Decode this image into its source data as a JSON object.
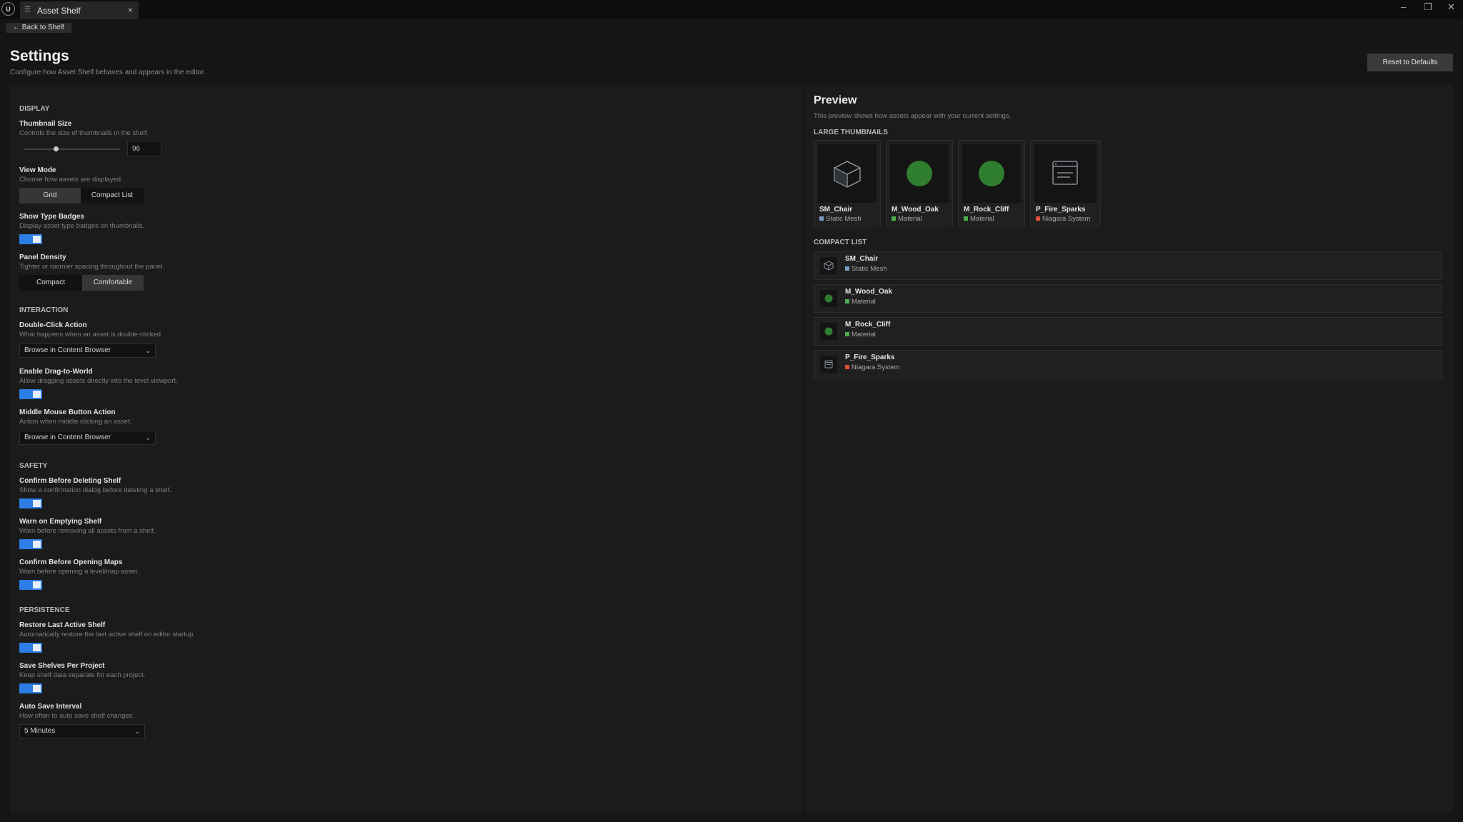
{
  "titlebar": {
    "logo": "U",
    "tab_title": "Asset Shelf",
    "tab_close": "×"
  },
  "window_controls": {
    "minimize": "–",
    "restore": "❐",
    "close": "✕"
  },
  "header": {
    "back_label": "← Back to Shelf",
    "title": "Settings",
    "subtitle": "Configure how Asset Shelf behaves and appears in the editor.",
    "reset_label": "Reset to Defaults"
  },
  "display": {
    "section": "DISPLAY",
    "thumb_size_label": "Thumbnail Size",
    "thumb_size_desc": "Controls the size of thumbnails in the shelf.",
    "thumb_size_value": "96",
    "view_mode_label": "View Mode",
    "view_mode_desc": "Choose how assets are displayed.",
    "view_mode_options": [
      "Grid",
      "Compact List"
    ],
    "badges_label": "Show Type Badges",
    "badges_desc": "Display asset type badges on thumbnails.",
    "density_label": "Panel Density",
    "density_desc": "Tighter or roomier spacing throughout the panel.",
    "density_options": [
      "Compact",
      "Comfortable"
    ]
  },
  "interaction": {
    "section": "INTERACTION",
    "dbl_label": "Double-Click Action",
    "dbl_desc": "What happens when an asset is double-clicked.",
    "dbl_value": "Browse in Content Browser",
    "drag_label": "Enable Drag-to-World",
    "drag_desc": "Allow dragging assets directly into the level viewport.",
    "mmb_label": "Middle Mouse Button Action",
    "mmb_desc": "Action when middle clicking an asset.",
    "mmb_value": "Browse in Content Browser"
  },
  "safety": {
    "section": "SAFETY",
    "del_label": "Confirm Before Deleting Shelf",
    "del_desc": "Show a confirmation dialog before deleting a shelf.",
    "empty_label": "Warn on Emptying Shelf",
    "empty_desc": "Warn before removing all assets from a shelf.",
    "maps_label": "Confirm Before Opening Maps",
    "maps_desc": "Warn before opening a level/map asset."
  },
  "persistence": {
    "section": "PERSISTENCE",
    "restore_label": "Restore Last Active Shelf",
    "restore_desc": "Automatically restore the last active shelf on editor startup.",
    "per_project_label": "Save Shelves Per Project",
    "per_project_desc": "Keep shelf data separate for each project.",
    "autosave_label": "Auto Save Interval",
    "autosave_desc": "How often to auto save shelf changes.",
    "autosave_value": "5 Minutes"
  },
  "preview": {
    "title": "Preview",
    "subtitle": "This preview shows how assets appear with your current settings.",
    "large_header": "LARGE THUMBNAILS",
    "list_header": "COMPACT LIST",
    "assets": [
      {
        "name": "SM_Chair",
        "type": "Static Mesh",
        "icon": "cube-icon",
        "color": "#7a9cc4"
      },
      {
        "name": "M_Wood_Oak",
        "type": "Material",
        "icon": "material-sphere-icon",
        "color": "#4caf50"
      },
      {
        "name": "M_Rock_Cliff",
        "type": "Material",
        "icon": "material-sphere-icon",
        "color": "#4caf50"
      },
      {
        "name": "P_Fire_Sparks",
        "type": "Niagara System",
        "icon": "niagara-system-icon",
        "color": "#e0503a"
      }
    ]
  }
}
